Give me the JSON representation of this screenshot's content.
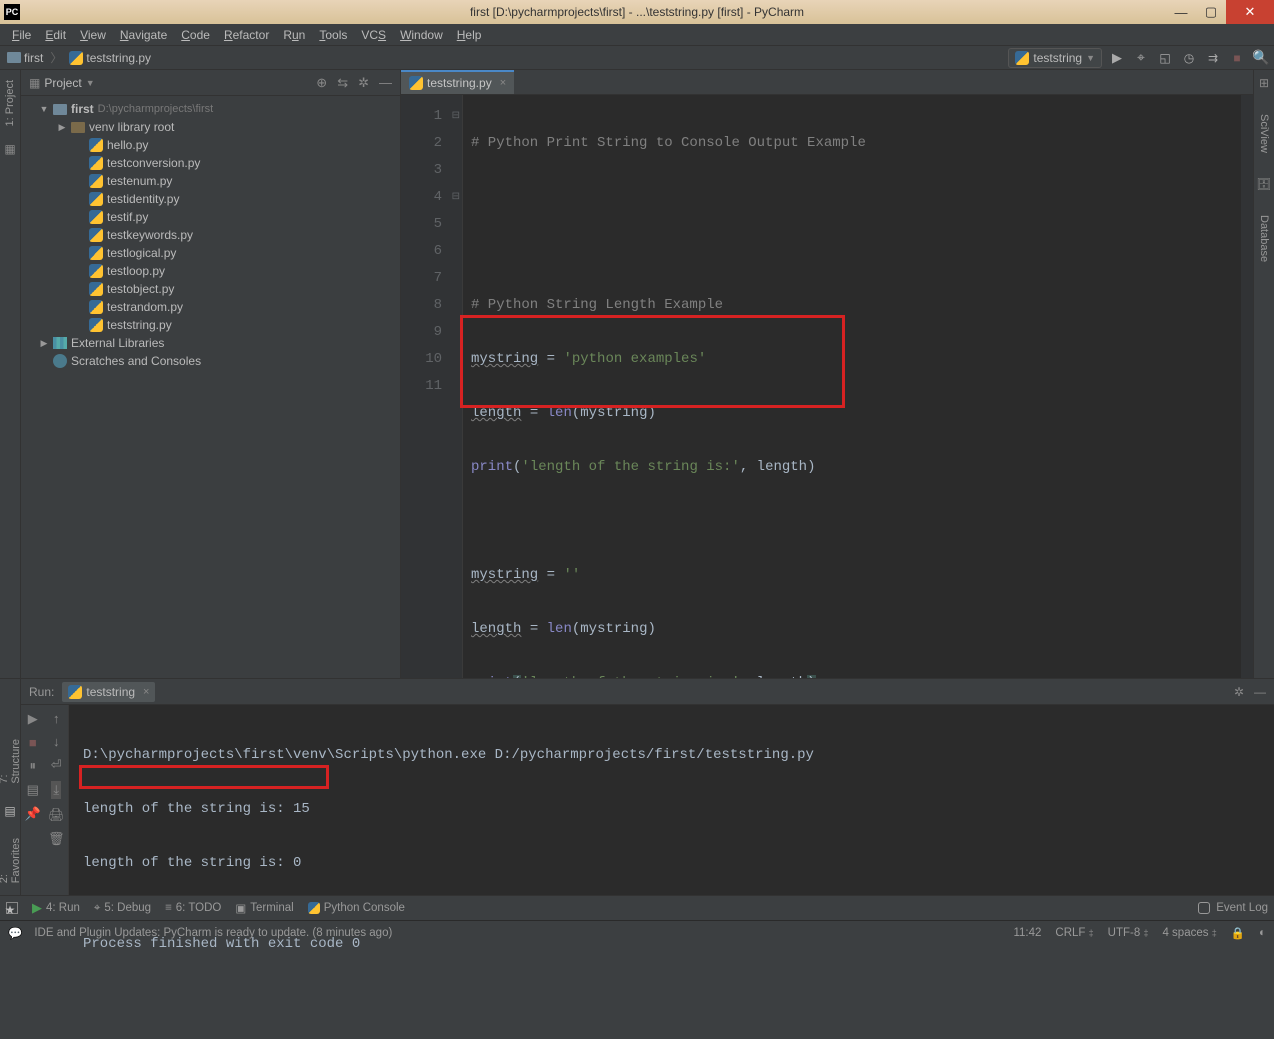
{
  "window": {
    "title": "first [D:\\pycharmprojects\\first] - ...\\teststring.py [first] - PyCharm",
    "pc": "PC"
  },
  "menu": [
    "File",
    "Edit",
    "View",
    "Navigate",
    "Code",
    "Refactor",
    "Run",
    "Tools",
    "VCS",
    "Window",
    "Help"
  ],
  "breadcrumb": {
    "root": "first",
    "file": "teststring.py"
  },
  "run_config": {
    "name": "teststring"
  },
  "project": {
    "panel_title": "Project",
    "root": {
      "name": "first",
      "path": "D:\\pycharmprojects\\first"
    },
    "venv": "venv library root",
    "files": [
      "hello.py",
      "testconversion.py",
      "testenum.py",
      "testidentity.py",
      "testif.py",
      "testkeywords.py",
      "testlogical.py",
      "testloop.py",
      "testobject.py",
      "testrandom.py",
      "teststring.py"
    ],
    "external": "External Libraries",
    "scratches": "Scratches and Consoles"
  },
  "editor": {
    "tab": "teststring.py",
    "lines": {
      "1": {
        "type": "comment",
        "text": "# Python Print String to Console Output Example"
      },
      "4": {
        "type": "comment",
        "text": "# Python String Length Example"
      },
      "5": {
        "a": "mystring",
        "op": " = ",
        "s": "'python examples'"
      },
      "6": {
        "a": "length",
        "op": " = ",
        "fn": "len",
        "arg": "mystring"
      },
      "7": {
        "fn": "print",
        "s": "'length of the string is:'",
        "sep": ", ",
        "arg": "length"
      },
      "9": {
        "a": "mystring",
        "op": " = ",
        "s": "''"
      },
      "10": {
        "a": "length",
        "op": " = ",
        "fn": "len",
        "arg": "mystring"
      },
      "11": {
        "fn": "print",
        "s": "'length of the string is:'",
        "sep": ", ",
        "arg": "length"
      }
    }
  },
  "run": {
    "label": "Run:",
    "tab": "teststring",
    "output": {
      "cmd": "D:\\pycharmprojects\\first\\venv\\Scripts\\python.exe D:/pycharmprojects/first/teststring.py",
      "l1": "length of the string is: 15",
      "l2": "length of the string is: 0",
      "exit": "Process finished with exit code 0"
    }
  },
  "left_rails": {
    "project": "1: Project",
    "structure": "7: Structure",
    "favorites": "2: Favorites"
  },
  "right_rails": {
    "sciview": "SciView",
    "database": "Database"
  },
  "bottom_tabs": {
    "run": "4: Run",
    "debug": "5: Debug",
    "todo": "6: TODO",
    "terminal": "Terminal",
    "pyconsole": "Python Console",
    "eventlog": "Event Log"
  },
  "status": {
    "msg": "IDE and Plugin Updates: PyCharm is ready to update. (8 minutes ago)",
    "pos": "11:42",
    "eol": "CRLF",
    "enc": "UTF-8",
    "indent": "4 spaces"
  }
}
